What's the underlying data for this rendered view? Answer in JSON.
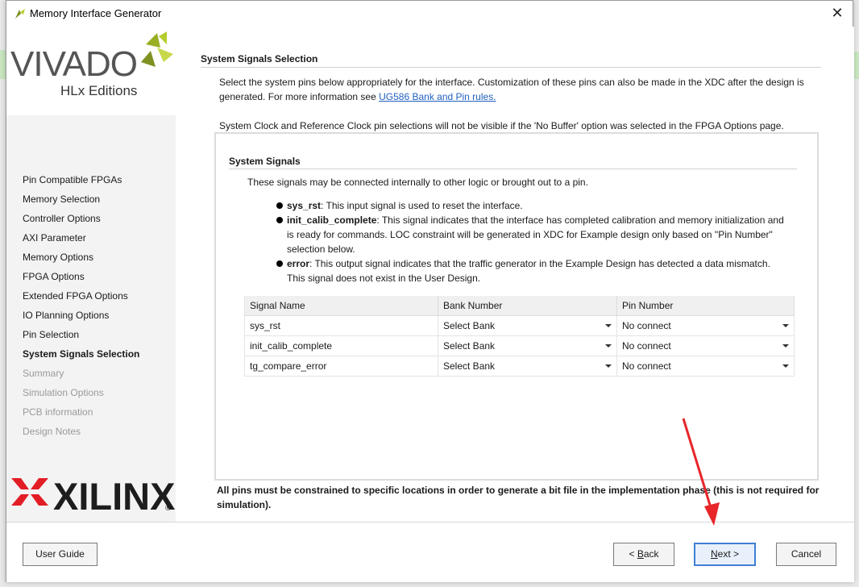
{
  "window": {
    "title": "Memory Interface Generator"
  },
  "logo": {
    "brand": "VIVADO",
    "edition": "HLx Editions",
    "vendor": "XILINX",
    "reg_mark": "®"
  },
  "nav": {
    "items": [
      {
        "label": "Pin Compatible FPGAs",
        "state": "normal"
      },
      {
        "label": "Memory Selection",
        "state": "normal"
      },
      {
        "label": "Controller Options",
        "state": "normal"
      },
      {
        "label": "AXI Parameter",
        "state": "normal"
      },
      {
        "label": "Memory Options",
        "state": "normal"
      },
      {
        "label": "FPGA Options",
        "state": "normal"
      },
      {
        "label": "Extended FPGA Options",
        "state": "normal"
      },
      {
        "label": "IO Planning Options",
        "state": "normal"
      },
      {
        "label": "Pin Selection",
        "state": "normal"
      },
      {
        "label": "System Signals Selection",
        "state": "active"
      },
      {
        "label": "Summary",
        "state": "disabled"
      },
      {
        "label": "Simulation Options",
        "state": "disabled"
      },
      {
        "label": "PCB information",
        "state": "disabled"
      },
      {
        "label": "Design Notes",
        "state": "disabled"
      }
    ]
  },
  "content": {
    "title": "System Signals Selection",
    "intro_text": "Select the system pins below appropriately for the interface. Customization of these pins can also be made in the XDC after the design is generated. For more information see ",
    "intro_link": "UG586 Bank and Pin rules.",
    "clock_note": "System Clock and Reference Clock pin selections will not be visible if the 'No Buffer' option was selected in the FPGA Options page.",
    "panel": {
      "title": "System Signals",
      "description": "These signals may be connected internally to other logic or brought out to a pin.",
      "bullets": [
        {
          "name": "sys_rst",
          "text": ": This input signal is used to reset the interface."
        },
        {
          "name": "init_calib_complete",
          "text": ": This signal indicates that the interface has completed calibration and memory initialization and is ready for commands. LOC constraint will be generated in XDC for Example design only based on \"Pin Number\" selection below."
        },
        {
          "name": "error",
          "text": ": This output signal indicates that the traffic generator in the Example Design has detected a data mismatch. This signal does not exist in the User Design."
        }
      ],
      "table": {
        "headers": [
          "Signal Name",
          "Bank Number",
          "Pin Number"
        ],
        "rows": [
          {
            "signal": "sys_rst",
            "bank": "Select Bank",
            "pin": "No connect"
          },
          {
            "signal": "init_calib_complete",
            "bank": "Select Bank",
            "pin": "No connect"
          },
          {
            "signal": "tg_compare_error",
            "bank": "Select Bank",
            "pin": "No connect"
          }
        ]
      }
    },
    "warning": "All pins must be constrained to specific locations in order to generate a bit file in the implementation phase (this is not required for simulation)."
  },
  "footer": {
    "user_guide": "User Guide",
    "back_mnemonic": "B",
    "back_rest": "ack",
    "back_prefix": "< ",
    "next_mnemonic": "N",
    "next_rest": "ext >",
    "cancel": "Cancel"
  },
  "colors": {
    "accent": "#3f7fd4",
    "link": "#1f5fbf",
    "annotation_arrow": "#e8262a",
    "xilinx_red": "#e31d25",
    "vivado_green": "#b7cc2f"
  }
}
